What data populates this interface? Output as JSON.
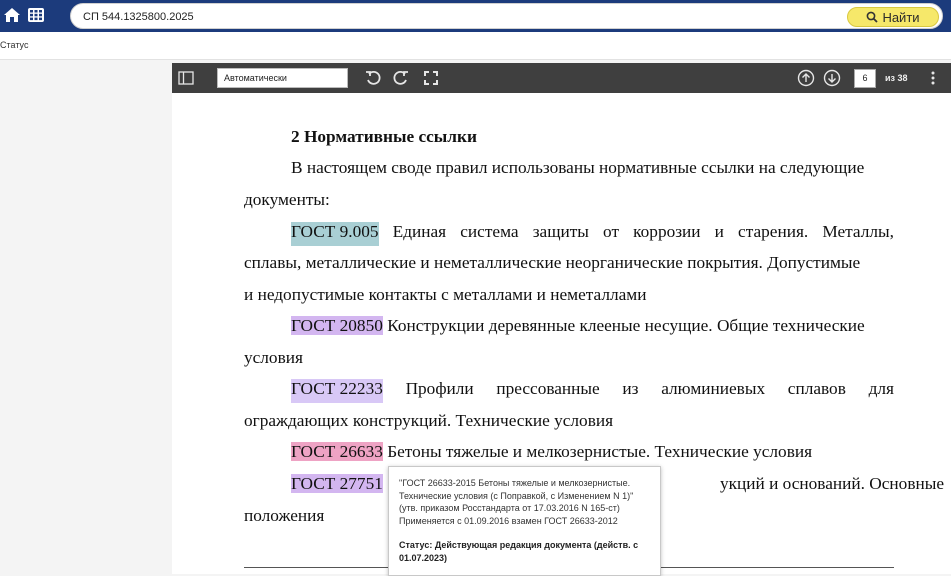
{
  "topbar": {
    "search_value": "СП 544.1325800.2025",
    "find_label": "Найти"
  },
  "status_row": {
    "label": "Статус"
  },
  "viewer": {
    "zoom_value": "Автоматически",
    "page_current": "6",
    "page_total": "из 38"
  },
  "document": {
    "heading": "2 Нормативные ссылки",
    "intro_line1": "В настоящем своде правил использованы нормативные ссылки на следующие",
    "intro_line2": "документы:",
    "ref1": {
      "code": "ГОСТ 9.005",
      "line1_words": [
        "Единая",
        "система",
        "защиты",
        "от",
        "коррозии",
        "и",
        "старения.",
        "Металлы,"
      ],
      "line2": "сплавы, металлические и неметаллические неорганические покрытия. Допустимые",
      "line3": "и недопустимые контакты с металлами и неметаллами"
    },
    "ref2": {
      "code": "ГОСТ 20850",
      "line1_rest": "Конструкции деревянные клееные несущие. Общие технические",
      "line2": "условия"
    },
    "ref3": {
      "code": "ГОСТ 22233",
      "line1_words": [
        "Профили",
        "прессованные",
        "из",
        "алюминиевых",
        "сплавов",
        "для"
      ],
      "line2": "ограждающих конструкций. Технические условия"
    },
    "ref4": {
      "code": "ГОСТ 26633",
      "line1_rest": "Бетоны тяжелые и мелкозернистые. Технические условия"
    },
    "ref5": {
      "code": "ГОСТ 27751",
      "line1_rest_visible": "укций и оснований. Основные",
      "line2": "положения"
    }
  },
  "tooltip": {
    "line1": "\"ГОСТ 26633-2015 Бетоны тяжелые и мелкозернистые.",
    "line2": "Технические условия (с Поправкой, с Изменением N 1)\"",
    "line3": "(утв. приказом Росстандарта от 17.03.2016 N 165-ст)",
    "line4": "Применяется с 01.09.2016 взамен ГОСТ 26633-2012",
    "status1": "Статус: Действующая редакция документа (действ. с",
    "status2": "01.07.2023)"
  },
  "colors": {
    "topbar": "#1c3b7c",
    "find_button": "#f6e86a",
    "viewer_toolbar": "#3f3f3f",
    "highlight_teal": "#a9cfd4",
    "highlight_purple": "#d3b6f0",
    "highlight_pink": "#eea3c4"
  }
}
